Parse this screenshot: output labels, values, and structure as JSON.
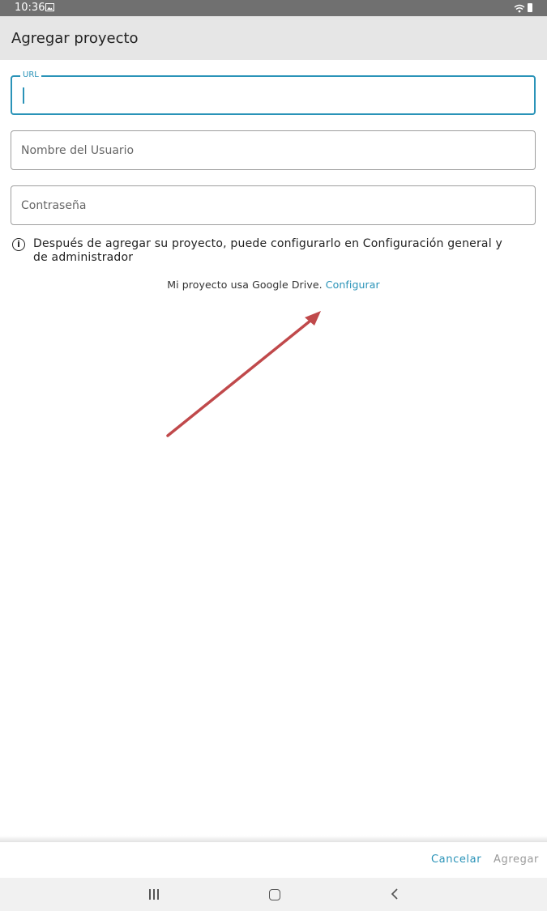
{
  "status_bar": {
    "time": "10:36"
  },
  "appbar": {
    "title": "Agregar proyecto"
  },
  "form": {
    "url": {
      "label": "URL",
      "value": ""
    },
    "username": {
      "placeholder": "Nombre del Usuario",
      "value": ""
    },
    "password": {
      "placeholder": "Contraseña",
      "value": ""
    }
  },
  "info_text": "Después de agregar su proyecto, puede configurarlo en Configuración general y de administrador",
  "google_drive": {
    "text": "Mi proyecto usa Google Drive.",
    "link": "Configurar"
  },
  "actions": {
    "cancel": "Cancelar",
    "add": "Agregar"
  },
  "colors": {
    "accent": "#2a93b8",
    "annotation_arrow": "#c0494b",
    "appbar_bg": "#e6e6e6",
    "statusbar_bg": "#707070"
  },
  "icons": [
    "image-icon",
    "wifi-icon",
    "battery-icon",
    "info-icon",
    "recent-apps-icon",
    "home-icon",
    "back-icon"
  ]
}
